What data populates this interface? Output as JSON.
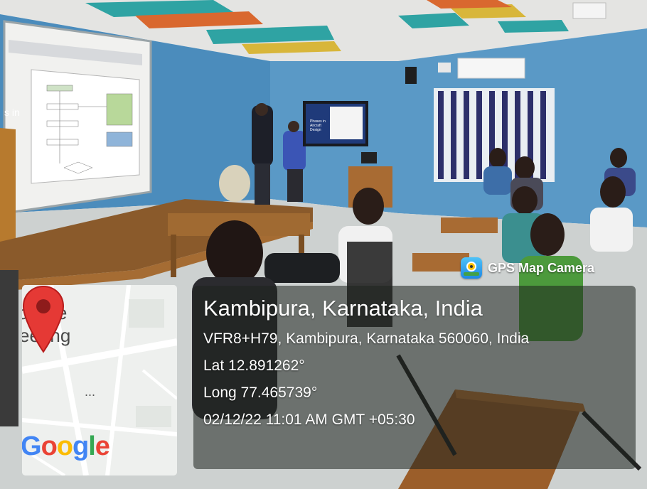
{
  "badge": {
    "label": "GPS Map Camera",
    "icon": "gps-map-camera-icon"
  },
  "location": {
    "title": "Kambipura, Karnataka, India",
    "address": "VFR8+H79, Kambipura, Karnataka 560060, India",
    "latitude": "Lat 12.891262°",
    "longitude": "Long 77.465739°",
    "datetime": "02/12/22 11:01 AM GMT +05:30"
  },
  "map": {
    "label_line1": "ollege",
    "label_line2": "eering",
    "ellipsis": "...",
    "logo_letters": [
      "G",
      "o",
      "o",
      "g",
      "l",
      "e"
    ],
    "pin_icon": "map-pin-icon"
  },
  "screen_left_edge_text": "s in",
  "tv_text": "Phases in Aircraft Design",
  "colors": {
    "wall": "#4f8fbe",
    "ceiling": "#e6e6e6",
    "floor": "#cfd3d2",
    "stage": "#8a5a2b",
    "pin": "#e53935"
  }
}
